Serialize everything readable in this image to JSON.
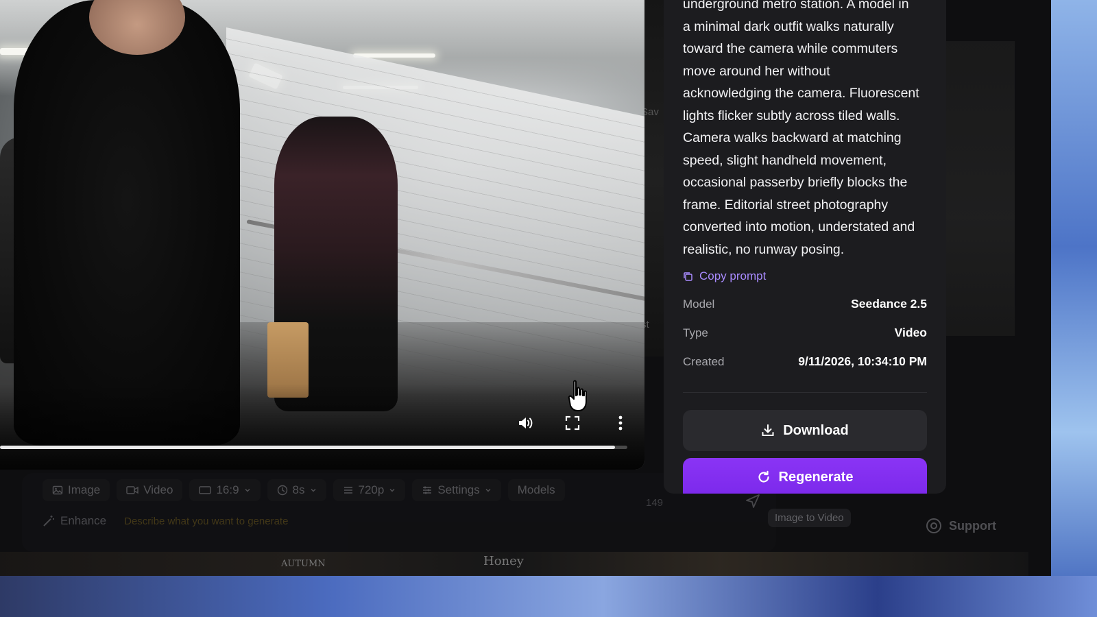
{
  "details": {
    "prompt": "underground metro station. A model in\na minimal dark outfit walks naturally\ntoward the camera while commuters\nmove around her without\nacknowledging the camera. Fluorescent\nlights flicker subtly across tiled walls.\nCamera walks backward at matching\nspeed, slight handheld movement,\noccasional passerby briefly blocks the\nframe. Editorial street photography\nconverted into motion, understated and\nrealistic, no runway posing.",
    "copy_prompt_label": "Copy prompt",
    "meta": [
      {
        "label": "Model",
        "value": "Seedance 2.5"
      },
      {
        "label": "Type",
        "value": "Video"
      },
      {
        "label": "Created",
        "value": "9/11/2026, 10:34:10 PM"
      }
    ],
    "download_label": "Download",
    "regenerate_label": "Regenerate"
  },
  "video": {
    "progress": 0.98,
    "icons": [
      "volume-icon",
      "fullscreen-icon",
      "more-vertical-icon"
    ]
  },
  "composer": {
    "toolbar": [
      {
        "label": "Image",
        "icon": "image-icon"
      },
      {
        "label": "Video",
        "icon": "video-icon"
      },
      {
        "label": "16:9",
        "icon": "aspect-ratio-icon"
      },
      {
        "label": "8s",
        "icon": "clock-icon"
      },
      {
        "label": "720p",
        "icon": "resolution-icon"
      },
      {
        "label": "Settings",
        "icon": "sliders-icon"
      },
      {
        "label": "Models",
        "icon": ""
      }
    ],
    "enhance_label": "Enhance",
    "placeholder": "Describe what you want to generate",
    "char_count": "149"
  },
  "chips": {
    "image_to_video": "Image to Video",
    "support": "Support"
  },
  "background": {
    "ghost_save": "Sav",
    "ghost_st": "st",
    "thumb_text_1": "AUTUMN",
    "thumb_text_2": "Honey"
  },
  "colors": {
    "accent": "#7a28ea",
    "link": "#a98bff",
    "panel_bg": "#1c1c1f"
  }
}
